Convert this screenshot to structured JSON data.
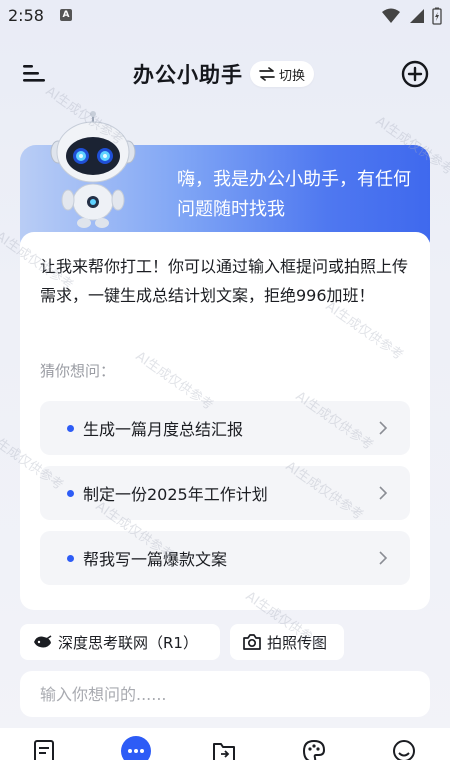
{
  "status": {
    "time": "2:58",
    "notification_badge": "A",
    "icons": [
      "wifi-icon",
      "signal-icon",
      "battery-charging-icon"
    ]
  },
  "header": {
    "title": "办公小助手",
    "switch_label": "切换",
    "menu_icon": "menu-icon",
    "add_icon": "add-circle-icon"
  },
  "hero": {
    "greeting": "嗨，我是办公小助手，有任何问题随时找我"
  },
  "main": {
    "intro": "让我来帮你打工！你可以通过输入框提问或拍照上传需求，一键生成总结计划文案，拒绝996加班！",
    "guess_label": "猜你想问：",
    "suggestions": [
      {
        "label": "生成一篇月度总结汇报"
      },
      {
        "label": "制定一份2025年工作计划"
      },
      {
        "label": "帮我写一篇爆款文案"
      }
    ]
  },
  "chips": {
    "deep_think": "深度思考联网（R1）",
    "photo_upload": "拍照传图"
  },
  "input": {
    "placeholder": "输入你想问的......"
  },
  "watermark": "AI生成仅供参考",
  "bottom_nav": {
    "items": [
      "document-icon",
      "chat-icon",
      "folder-icon",
      "palette-icon",
      "smile-icon"
    ],
    "active": "chat-icon"
  },
  "colors": {
    "accent": "#2d5cf6",
    "hero_gradient_start": "#b9cdf5",
    "hero_gradient_end": "#3f69ee"
  }
}
